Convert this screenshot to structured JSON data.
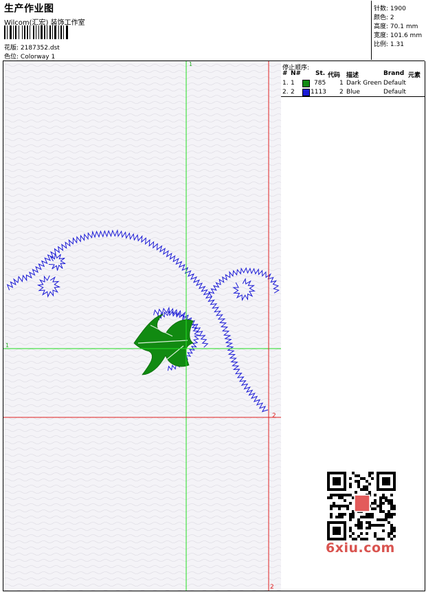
{
  "header": {
    "title": "生产作业图",
    "company": "Wilcom(汇宏) 装饰工作室",
    "design_label": "花版:",
    "design_file": "2187352.dst",
    "colorway_label": "色位:",
    "colorway": "Colorway 1"
  },
  "stats": [
    {
      "label": "针数:",
      "value": "1900"
    },
    {
      "label": "颜色:",
      "value": "2"
    },
    {
      "label": "高度:",
      "value": "70.1 mm"
    },
    {
      "label": "宽度:",
      "value": "101.6 mm"
    },
    {
      "label": "比例:",
      "value": "1.31"
    }
  ],
  "stop_sequence": {
    "title": "停止顺序:",
    "columns": [
      "#",
      "N#",
      "St.",
      "代码",
      "描述",
      "Brand",
      "元素"
    ],
    "rows": [
      {
        "num": "1.",
        "n": "1",
        "stitches": "785",
        "code": "1",
        "description": "Dark Green",
        "brand": "Default",
        "color": "#118a11"
      },
      {
        "num": "2.",
        "n": "2",
        "stitches": "1113",
        "code": "2",
        "description": "Blue",
        "brand": "Default",
        "color": "#1c1cd6"
      }
    ]
  },
  "guides": {
    "green_v": "1",
    "green_h": "1",
    "red_v": "2",
    "red_h": "2",
    "green_color": "#22dd22",
    "red_color": "#e02020"
  },
  "watermark": "6xiu.com"
}
